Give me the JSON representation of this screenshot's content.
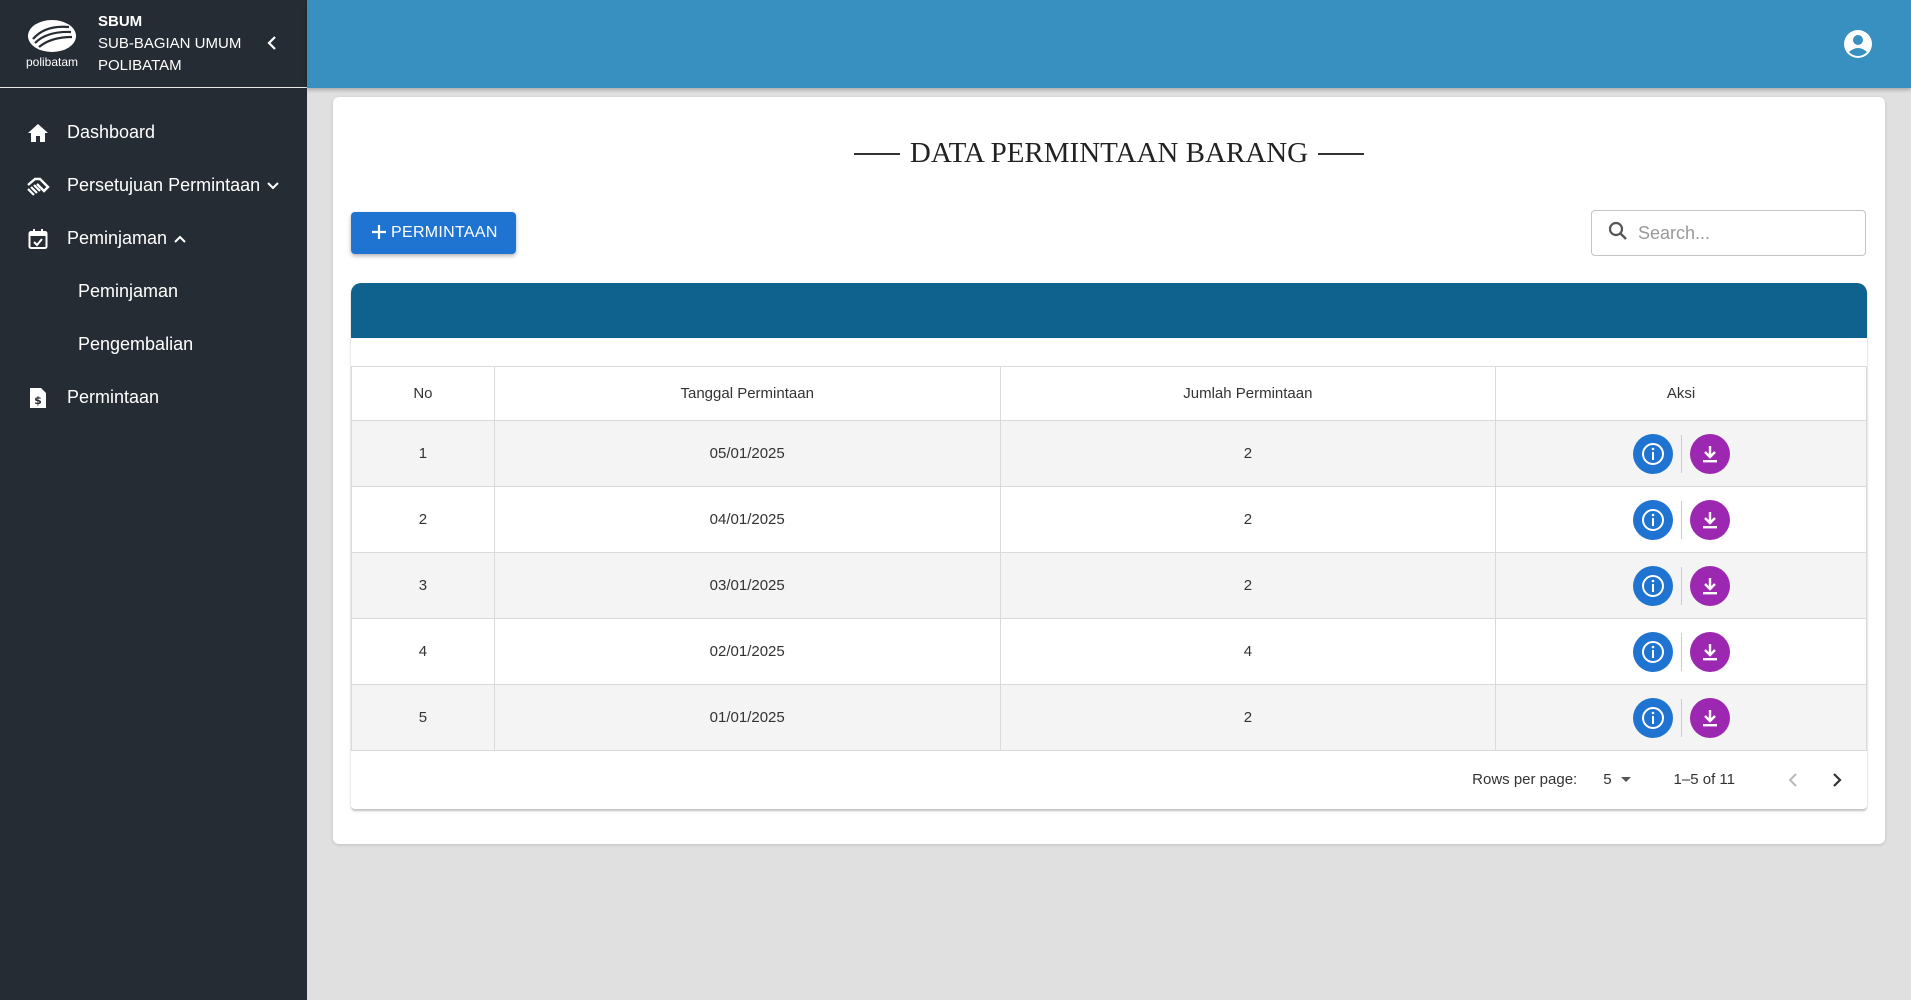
{
  "brand": {
    "line1": "SBUM",
    "line2": "SUB-BAGIAN UMUM",
    "line3": "POLIBATAM",
    "logo_text": "polibatam"
  },
  "sidebar": {
    "items": [
      {
        "label": "Dashboard",
        "icon": "home-icon"
      },
      {
        "label": "Persetujuan Permintaan",
        "icon": "handshake-icon"
      },
      {
        "label": "Peminjaman",
        "icon": "calendar-check-icon"
      },
      {
        "label": "Peminjaman",
        "icon": null
      },
      {
        "label": "Pengembalian",
        "icon": null
      },
      {
        "label": "Permintaan",
        "icon": "file-invoice-icon"
      }
    ]
  },
  "main": {
    "title": "DATA PERMINTAAN BARANG",
    "add_button": "PERMINTAAN",
    "search_placeholder": "Search...",
    "table": {
      "columns": [
        "No",
        "Tanggal Permintaan",
        "Jumlah Permintaan",
        "Aksi"
      ],
      "rows": [
        {
          "no": "1",
          "tanggal": "05/01/2025",
          "jumlah": "2"
        },
        {
          "no": "2",
          "tanggal": "04/01/2025",
          "jumlah": "2"
        },
        {
          "no": "3",
          "tanggal": "03/01/2025",
          "jumlah": "2"
        },
        {
          "no": "4",
          "tanggal": "02/01/2025",
          "jumlah": "4"
        },
        {
          "no": "5",
          "tanggal": "01/01/2025",
          "jumlah": "2"
        }
      ]
    },
    "pagination": {
      "rows_per_page_label": "Rows per page:",
      "rows_per_page": "5",
      "range": "1–5 of 11"
    }
  },
  "colors": {
    "sidebar_bg": "#252c33",
    "topbar_bg": "#3890c0",
    "table_band": "#0f628e",
    "primary": "#1f73d1",
    "download": "#9c27b0"
  }
}
